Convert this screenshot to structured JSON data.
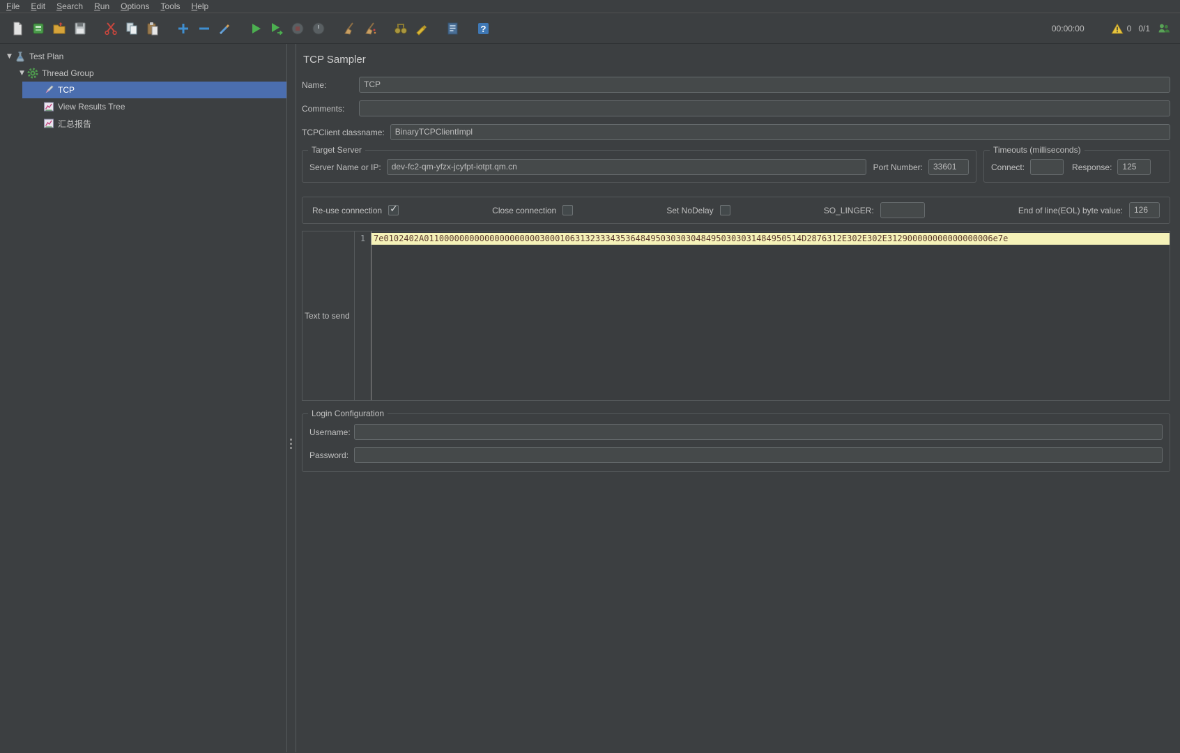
{
  "menubar": {
    "items": [
      {
        "label": "File"
      },
      {
        "label": "Edit"
      },
      {
        "label": "Search"
      },
      {
        "label": "Run"
      },
      {
        "label": "Options"
      },
      {
        "label": "Tools"
      },
      {
        "label": "Help"
      }
    ]
  },
  "toolbar": {
    "icons": [
      "new-file",
      "templates",
      "open",
      "save",
      "cut",
      "copy",
      "paste",
      "add",
      "remove",
      "toggle",
      "start",
      "start-no-pauses",
      "stop",
      "shutdown",
      "clear",
      "clear-all",
      "search",
      "search-reset",
      "function-helper",
      "help"
    ],
    "elapsed_time": "00:00:00",
    "warning_count": "0",
    "thread_counter": "0/1"
  },
  "tree": {
    "items": [
      {
        "label": "Test Plan",
        "depth": 0,
        "icon": "test-plan",
        "expanded": true,
        "selected": false
      },
      {
        "label": "Thread Group",
        "depth": 1,
        "icon": "thread-group",
        "expanded": true,
        "selected": false
      },
      {
        "label": "TCP",
        "depth": 2,
        "icon": "tcp-sampler",
        "selected": true
      },
      {
        "label": "View Results Tree",
        "depth": 2,
        "icon": "listener-chart",
        "selected": false
      },
      {
        "label": "汇总报告",
        "depth": 2,
        "icon": "listener-chart",
        "selected": false
      }
    ]
  },
  "main": {
    "title": "TCP Sampler",
    "groups": {
      "target_server": "Target Server",
      "timeouts": "Timeouts (milliseconds)",
      "login": "Login Configuration"
    },
    "fields": {
      "name": {
        "label": "Name:",
        "value": "TCP"
      },
      "comments": {
        "label": "Comments:",
        "value": ""
      },
      "classname": {
        "label": "TCPClient classname:",
        "value": "BinaryTCPClientImpl"
      },
      "server": {
        "label": "Server Name or IP:",
        "value": "dev-fc2-qm-yfzx-jcyfpt-iotpt.qm.cn"
      },
      "port": {
        "label": "Port Number:",
        "value": "33601"
      },
      "connect_timeout": {
        "label": "Connect:",
        "value": ""
      },
      "response_timeout": {
        "label": "Response:",
        "value": "125"
      },
      "so_linger": {
        "label": "SO_LINGER:",
        "value": ""
      },
      "eol": {
        "label": "End of line(EOL) byte value:",
        "value": "126"
      },
      "username": {
        "label": "Username:",
        "value": ""
      },
      "password": {
        "label": "Password:",
        "value": ""
      }
    },
    "checkboxes": {
      "reuse": {
        "label": "Re-use connection",
        "checked": true
      },
      "close": {
        "label": "Close connection",
        "checked": false
      },
      "nodelay": {
        "label": "Set NoDelay",
        "checked": false
      }
    },
    "editor": {
      "label": "Text to send",
      "line_number": "1",
      "line1": "7e0102402A011000000000000000000003000106313233343536484950303030484950303031484950514D2876312E302E302E312900000000000000006e7e"
    }
  }
}
